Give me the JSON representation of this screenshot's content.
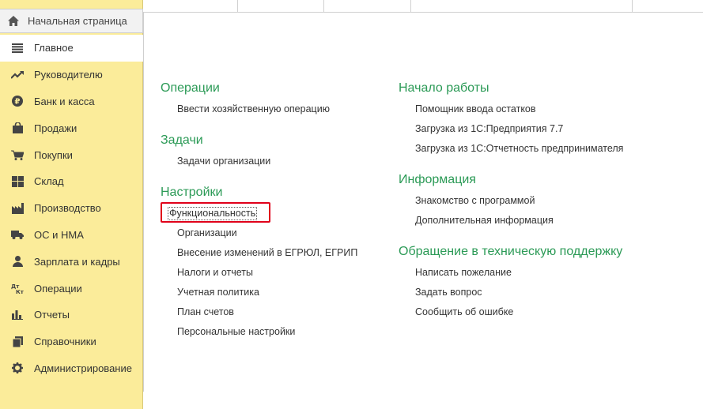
{
  "sidebar": {
    "home": {
      "label": "Начальная страница",
      "icon": "home-icon"
    },
    "items": [
      {
        "label": "Главное",
        "icon": "menu-lines-icon",
        "active": true
      },
      {
        "label": "Руководителю",
        "icon": "trend-up-icon"
      },
      {
        "label": "Банк и касса",
        "icon": "ruble-coin-icon"
      },
      {
        "label": "Продажи",
        "icon": "shopping-bag-icon"
      },
      {
        "label": "Покупки",
        "icon": "cart-icon"
      },
      {
        "label": "Склад",
        "icon": "warehouse-grid-icon"
      },
      {
        "label": "Производство",
        "icon": "factory-icon"
      },
      {
        "label": "ОС и НМА",
        "icon": "truck-icon"
      },
      {
        "label": "Зарплата и кадры",
        "icon": "person-icon"
      },
      {
        "label": "Операции",
        "icon": "dt-kt-icon",
        "icon_text": "Дт Кт"
      },
      {
        "label": "Отчеты",
        "icon": "bar-chart-icon"
      },
      {
        "label": "Справочники",
        "icon": "books-icon"
      },
      {
        "label": "Администрирование",
        "icon": "gear-icon"
      }
    ]
  },
  "content": {
    "col1": [
      {
        "title": "Операции",
        "links": [
          "Ввести хозяйственную операцию"
        ]
      },
      {
        "title": "Задачи",
        "links": [
          "Задачи организации"
        ]
      },
      {
        "title": "Настройки",
        "highlighted": "Функциональность",
        "links": [
          "Организации",
          "Внесение изменений в ЕГРЮЛ, ЕГРИП",
          "Налоги и отчеты",
          "Учетная политика",
          "План счетов",
          "Персональные настройки"
        ]
      }
    ],
    "col2": [
      {
        "title": "Начало работы",
        "links": [
          "Помощник ввода остатков",
          "Загрузка из 1С:Предприятия 7.7",
          "Загрузка из 1С:Отчетность предпринимателя"
        ]
      },
      {
        "title": "Информация",
        "links": [
          "Знакомство с программой",
          "Дополнительная информация"
        ]
      },
      {
        "title": "Обращение в техническую поддержку",
        "links": [
          "Написать пожелание",
          "Задать вопрос",
          "Сообщить об ошибке"
        ]
      }
    ]
  },
  "colors": {
    "sidebar_bg": "#fbec9a",
    "section_title": "#2b9a56",
    "highlight_border": "#e0001a"
  }
}
